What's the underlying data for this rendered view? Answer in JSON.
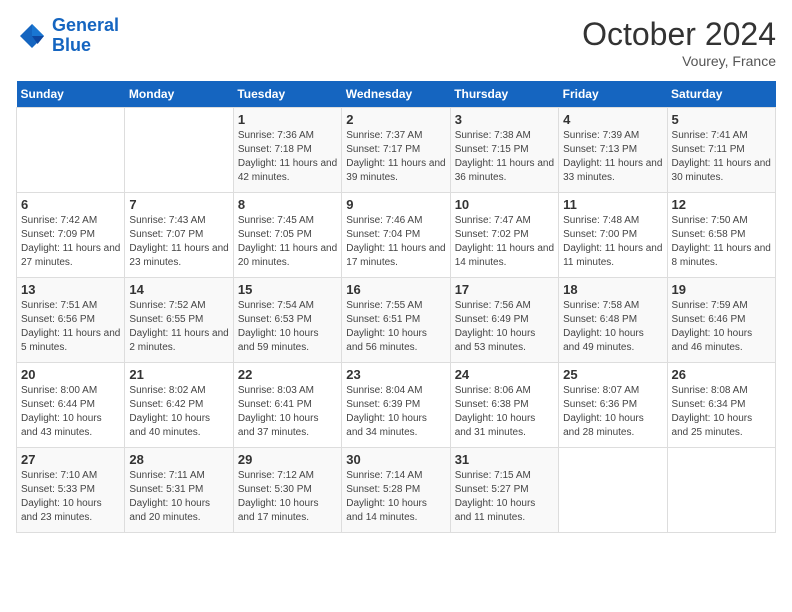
{
  "header": {
    "logo_line1": "General",
    "logo_line2": "Blue",
    "month": "October 2024",
    "location": "Vourey, France"
  },
  "weekdays": [
    "Sunday",
    "Monday",
    "Tuesday",
    "Wednesday",
    "Thursday",
    "Friday",
    "Saturday"
  ],
  "weeks": [
    [
      {
        "day": "",
        "detail": ""
      },
      {
        "day": "",
        "detail": ""
      },
      {
        "day": "1",
        "detail": "Sunrise: 7:36 AM\nSunset: 7:18 PM\nDaylight: 11 hours and 42 minutes."
      },
      {
        "day": "2",
        "detail": "Sunrise: 7:37 AM\nSunset: 7:17 PM\nDaylight: 11 hours and 39 minutes."
      },
      {
        "day": "3",
        "detail": "Sunrise: 7:38 AM\nSunset: 7:15 PM\nDaylight: 11 hours and 36 minutes."
      },
      {
        "day": "4",
        "detail": "Sunrise: 7:39 AM\nSunset: 7:13 PM\nDaylight: 11 hours and 33 minutes."
      },
      {
        "day": "5",
        "detail": "Sunrise: 7:41 AM\nSunset: 7:11 PM\nDaylight: 11 hours and 30 minutes."
      }
    ],
    [
      {
        "day": "6",
        "detail": "Sunrise: 7:42 AM\nSunset: 7:09 PM\nDaylight: 11 hours and 27 minutes."
      },
      {
        "day": "7",
        "detail": "Sunrise: 7:43 AM\nSunset: 7:07 PM\nDaylight: 11 hours and 23 minutes."
      },
      {
        "day": "8",
        "detail": "Sunrise: 7:45 AM\nSunset: 7:05 PM\nDaylight: 11 hours and 20 minutes."
      },
      {
        "day": "9",
        "detail": "Sunrise: 7:46 AM\nSunset: 7:04 PM\nDaylight: 11 hours and 17 minutes."
      },
      {
        "day": "10",
        "detail": "Sunrise: 7:47 AM\nSunset: 7:02 PM\nDaylight: 11 hours and 14 minutes."
      },
      {
        "day": "11",
        "detail": "Sunrise: 7:48 AM\nSunset: 7:00 PM\nDaylight: 11 hours and 11 minutes."
      },
      {
        "day": "12",
        "detail": "Sunrise: 7:50 AM\nSunset: 6:58 PM\nDaylight: 11 hours and 8 minutes."
      }
    ],
    [
      {
        "day": "13",
        "detail": "Sunrise: 7:51 AM\nSunset: 6:56 PM\nDaylight: 11 hours and 5 minutes."
      },
      {
        "day": "14",
        "detail": "Sunrise: 7:52 AM\nSunset: 6:55 PM\nDaylight: 11 hours and 2 minutes."
      },
      {
        "day": "15",
        "detail": "Sunrise: 7:54 AM\nSunset: 6:53 PM\nDaylight: 10 hours and 59 minutes."
      },
      {
        "day": "16",
        "detail": "Sunrise: 7:55 AM\nSunset: 6:51 PM\nDaylight: 10 hours and 56 minutes."
      },
      {
        "day": "17",
        "detail": "Sunrise: 7:56 AM\nSunset: 6:49 PM\nDaylight: 10 hours and 53 minutes."
      },
      {
        "day": "18",
        "detail": "Sunrise: 7:58 AM\nSunset: 6:48 PM\nDaylight: 10 hours and 49 minutes."
      },
      {
        "day": "19",
        "detail": "Sunrise: 7:59 AM\nSunset: 6:46 PM\nDaylight: 10 hours and 46 minutes."
      }
    ],
    [
      {
        "day": "20",
        "detail": "Sunrise: 8:00 AM\nSunset: 6:44 PM\nDaylight: 10 hours and 43 minutes."
      },
      {
        "day": "21",
        "detail": "Sunrise: 8:02 AM\nSunset: 6:42 PM\nDaylight: 10 hours and 40 minutes."
      },
      {
        "day": "22",
        "detail": "Sunrise: 8:03 AM\nSunset: 6:41 PM\nDaylight: 10 hours and 37 minutes."
      },
      {
        "day": "23",
        "detail": "Sunrise: 8:04 AM\nSunset: 6:39 PM\nDaylight: 10 hours and 34 minutes."
      },
      {
        "day": "24",
        "detail": "Sunrise: 8:06 AM\nSunset: 6:38 PM\nDaylight: 10 hours and 31 minutes."
      },
      {
        "day": "25",
        "detail": "Sunrise: 8:07 AM\nSunset: 6:36 PM\nDaylight: 10 hours and 28 minutes."
      },
      {
        "day": "26",
        "detail": "Sunrise: 8:08 AM\nSunset: 6:34 PM\nDaylight: 10 hours and 25 minutes."
      }
    ],
    [
      {
        "day": "27",
        "detail": "Sunrise: 7:10 AM\nSunset: 5:33 PM\nDaylight: 10 hours and 23 minutes."
      },
      {
        "day": "28",
        "detail": "Sunrise: 7:11 AM\nSunset: 5:31 PM\nDaylight: 10 hours and 20 minutes."
      },
      {
        "day": "29",
        "detail": "Sunrise: 7:12 AM\nSunset: 5:30 PM\nDaylight: 10 hours and 17 minutes."
      },
      {
        "day": "30",
        "detail": "Sunrise: 7:14 AM\nSunset: 5:28 PM\nDaylight: 10 hours and 14 minutes."
      },
      {
        "day": "31",
        "detail": "Sunrise: 7:15 AM\nSunset: 5:27 PM\nDaylight: 10 hours and 11 minutes."
      },
      {
        "day": "",
        "detail": ""
      },
      {
        "day": "",
        "detail": ""
      }
    ]
  ]
}
